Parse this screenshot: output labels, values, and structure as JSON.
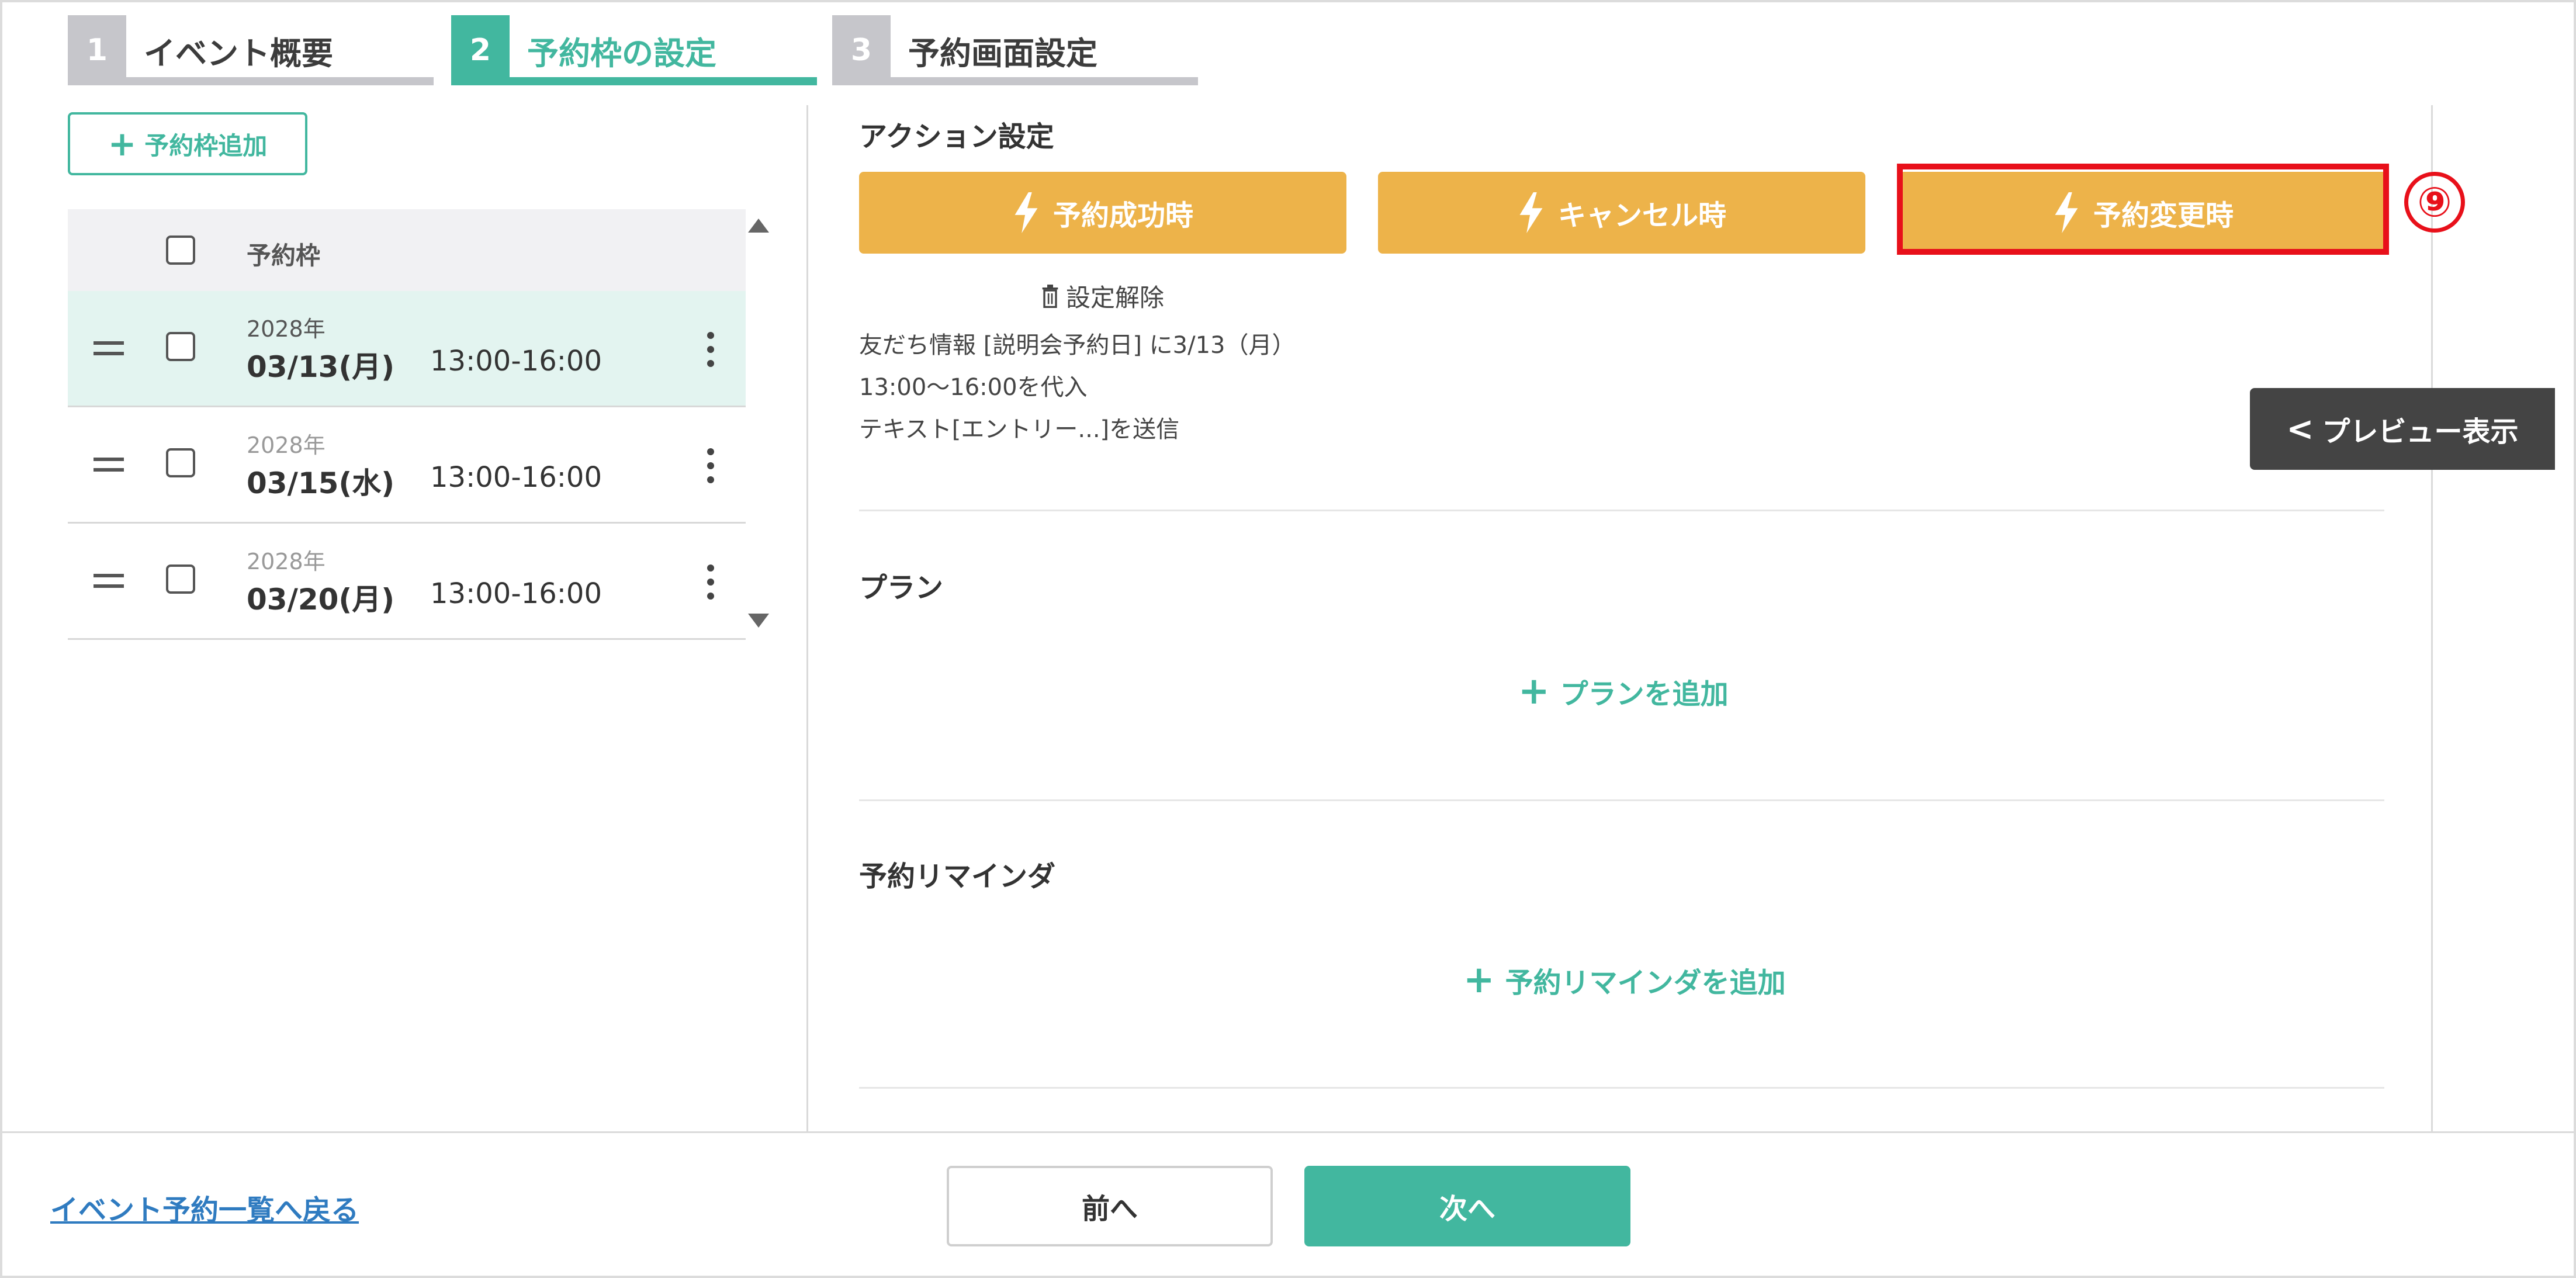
{
  "steps": [
    {
      "num": "1",
      "label": "イベント概要",
      "state": "inactive"
    },
    {
      "num": "2",
      "label": "予約枠の設定",
      "state": "active"
    },
    {
      "num": "3",
      "label": "予約画面設定",
      "state": "inactive"
    }
  ],
  "left": {
    "add_slot_label": "予約枠追加",
    "table_header": "予約枠",
    "slots": [
      {
        "year": "2028年",
        "date": "03/13(月)",
        "time": "13:00-16:00",
        "selected": true
      },
      {
        "year": "2028年",
        "date": "03/15(水)",
        "time": "13:00-16:00",
        "selected": false
      },
      {
        "year": "2028年",
        "date": "03/20(月)",
        "time": "13:00-16:00",
        "selected": false
      }
    ]
  },
  "actions": {
    "title": "アクション設定",
    "buttons": [
      {
        "label": "予約成功時"
      },
      {
        "label": "キャンセル時"
      },
      {
        "label": "予約変更時"
      }
    ],
    "annotation": "⑨",
    "clear_label": "設定解除",
    "desc_lines": [
      "友だち情報 [説明会予約日] に3/13（月）",
      "13:00〜16:00を代入",
      "テキスト[エントリー...]を送信"
    ]
  },
  "plan": {
    "title": "プラン",
    "add_label": "プランを追加"
  },
  "reminder": {
    "title": "予約リマインダ",
    "add_label": "予約リマインダを追加"
  },
  "preview": {
    "label": "プレビュー表示"
  },
  "footer": {
    "back_label": "イベント予約一覧へ戻る",
    "prev_label": "前へ",
    "next_label": "次へ"
  },
  "colors": {
    "primary": "#42b79f",
    "action": "#edb34a",
    "highlight": "#e8101a",
    "link": "#2f7bc0",
    "dark": "#444444"
  }
}
